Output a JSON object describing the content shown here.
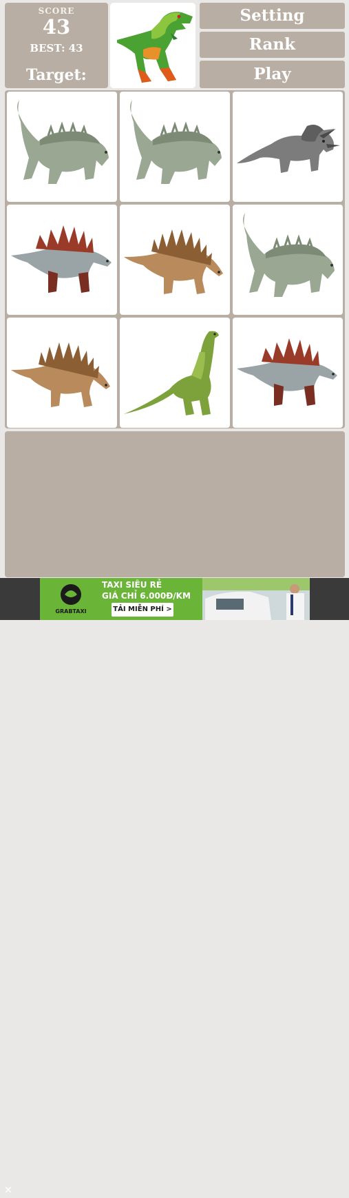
{
  "header": {
    "score_label": "SCORE",
    "score_value": "43",
    "best_label": "BEST: 43",
    "target_label": "Target:",
    "target_creature": "t-rex-icon"
  },
  "menu": {
    "setting_label": "Setting",
    "rank_label": "Rank",
    "play_label": "Play"
  },
  "board": {
    "tiles": [
      {
        "creature": "ankylosaurus-icon"
      },
      {
        "creature": "ankylosaurus-icon"
      },
      {
        "creature": "triceratops-icon"
      },
      {
        "creature": "stegosaurus-icon"
      },
      {
        "creature": "kentrosaurus-icon"
      },
      {
        "creature": "ankylosaurus-icon"
      },
      {
        "creature": "kentrosaurus-icon"
      },
      {
        "creature": "brachiosaurus-icon"
      },
      {
        "creature": "stegosaurus-icon"
      }
    ]
  },
  "ad": {
    "line1": "TAXI SIÊU RẺ",
    "line2": "GIÁ CHỈ 6.000Đ/KM",
    "cta": "TẢI MIỄN PHÍ >",
    "brand": "GRABTAXI",
    "close": "✕"
  },
  "colors": {
    "panel": "#b8aea4",
    "page": "#e9e8e6",
    "tile": "#ffffff",
    "ad_green": "#6ab437"
  }
}
